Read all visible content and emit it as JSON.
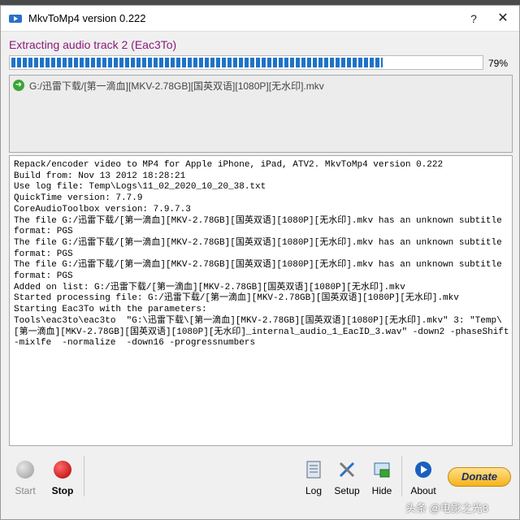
{
  "window": {
    "title": "MkvToMp4 version 0.222",
    "help": "?",
    "close": "✕"
  },
  "status": {
    "text": "Extracting audio track 2 (Eac3To)",
    "progress_percent": 79,
    "progress_label": "79%",
    "progress_color": "#1e73c8"
  },
  "file_list": {
    "items": [
      {
        "icon": "green-arrow-icon",
        "name": "G:/迅雷下载/[第一滴血][MKV-2.78GB][国英双语][1080P][无水印].mkv"
      }
    ]
  },
  "log": {
    "lines": [
      "Repack/encoder video to MP4 for Apple iPhone, iPad, ATV2. MkvToMp4 version 0.222",
      "Build from: Nov 13 2012 18:28:21",
      "Use log file: Temp\\Logs\\11_02_2020_10_20_38.txt",
      "QuickTime version: 7.7.9",
      "CoreAudioToolbox version: 7.9.7.3",
      "The file G:/迅雷下载/[第一滴血][MKV-2.78GB][国英双语][1080P][无水印].mkv has an unknown subtitle format: PGS",
      "The file G:/迅雷下载/[第一滴血][MKV-2.78GB][国英双语][1080P][无水印].mkv has an unknown subtitle format: PGS",
      "The file G:/迅雷下载/[第一滴血][MKV-2.78GB][国英双语][1080P][无水印].mkv has an unknown subtitle format: PGS",
      "Added on list: G:/迅雷下载/[第一滴血][MKV-2.78GB][国英双语][1080P][无水印].mkv",
      "Started processing file: G:/迅雷下载/[第一滴血][MKV-2.78GB][国英双语][1080P][无水印].mkv",
      "Starting Eac3To with the parameters:",
      "Tools\\eac3to\\eac3to  \"G:\\迅雷下载\\[第一滴血][MKV-2.78GB][国英双语][1080P][无水印].mkv\" 3: \"Temp\\[第一滴血][MKV-2.78GB][国英双语][1080P][无水印]_internal_audio_1_EacID_3.wav\" -down2 -phaseShift -mixlfe  -normalize  -down16 -progressnumbers"
    ]
  },
  "toolbar": {
    "start_label": "Start",
    "stop_label": "Stop",
    "log_label": "Log",
    "setup_label": "Setup",
    "hide_label": "Hide",
    "about_label": "About",
    "donate_label": "Donate"
  },
  "watermark": "头条 @电影之光8"
}
